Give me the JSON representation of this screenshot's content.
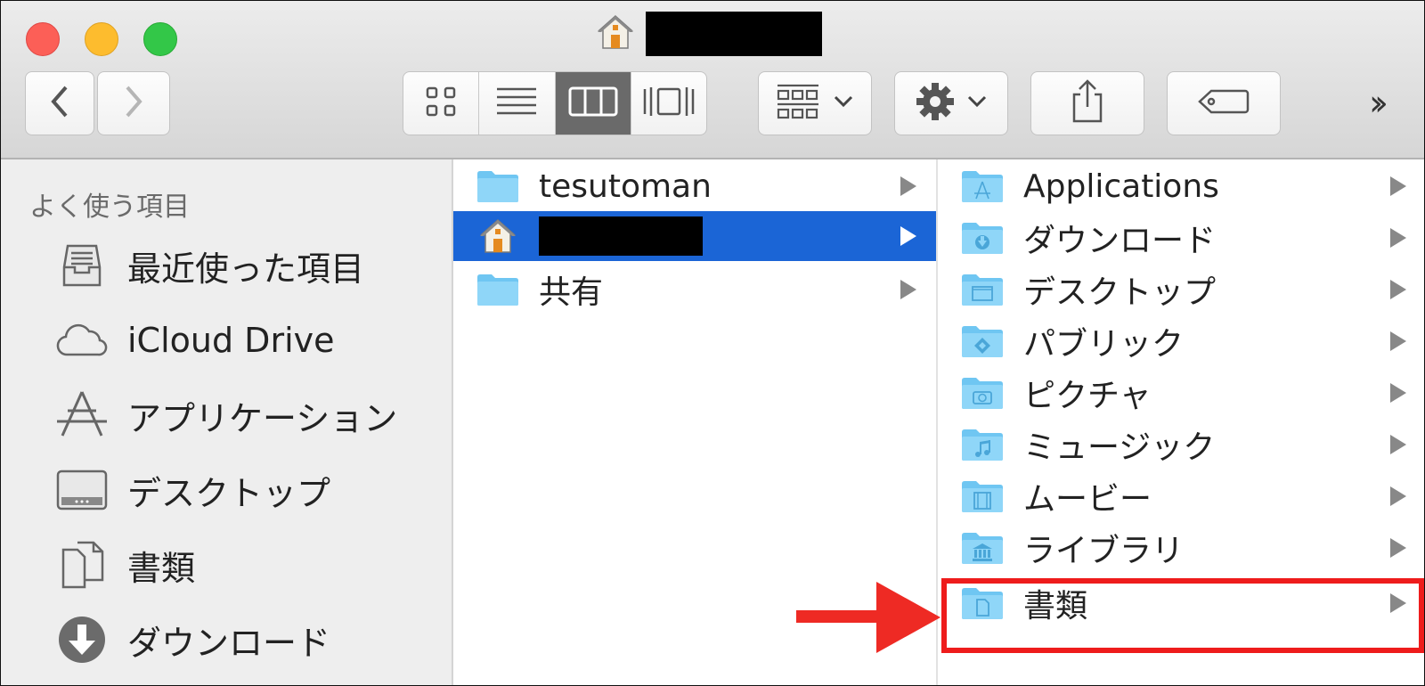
{
  "window": {
    "title_redacted": true
  },
  "toolbar": {
    "nav": {
      "back": "back-chevron-icon",
      "forward": "forward-chevron-icon"
    },
    "view_modes": [
      {
        "name": "icon-view",
        "active": false
      },
      {
        "name": "list-view",
        "active": false
      },
      {
        "name": "column-view",
        "active": true
      },
      {
        "name": "cover-flow-view",
        "active": false
      }
    ],
    "more_label": "››"
  },
  "sidebar": {
    "heading": "よく使う項目",
    "items": [
      {
        "label": "最近使った項目",
        "icon": "recents-icon"
      },
      {
        "label": "iCloud Drive",
        "icon": "icloud-icon"
      },
      {
        "label": "アプリケーション",
        "icon": "applications-icon"
      },
      {
        "label": "デスクトップ",
        "icon": "desktop-icon"
      },
      {
        "label": "書類",
        "icon": "documents-icon"
      },
      {
        "label": "ダウンロード",
        "icon": "downloads-icon"
      }
    ]
  },
  "column1": {
    "items": [
      {
        "label": "tesutoman",
        "icon": "folder-icon",
        "selected": false
      },
      {
        "label": "",
        "icon": "home-icon",
        "selected": true,
        "redacted": true
      },
      {
        "label": "共有",
        "icon": "folder-icon",
        "selected": false
      }
    ]
  },
  "column2": {
    "items": [
      {
        "label": "Applications",
        "icon": "applications-folder-icon"
      },
      {
        "label": "ダウンロード",
        "icon": "downloads-folder-icon"
      },
      {
        "label": "デスクトップ",
        "icon": "desktop-folder-icon"
      },
      {
        "label": "パブリック",
        "icon": "public-folder-icon"
      },
      {
        "label": "ピクチャ",
        "icon": "pictures-folder-icon"
      },
      {
        "label": "ミュージック",
        "icon": "music-folder-icon"
      },
      {
        "label": "ムービー",
        "icon": "movies-folder-icon"
      },
      {
        "label": "ライブラリ",
        "icon": "library-folder-icon"
      },
      {
        "label": "書類",
        "icon": "documents-folder-icon"
      }
    ]
  },
  "annotation": {
    "highlighted_item": "書類",
    "color": "#ee1c1c"
  },
  "colors": {
    "selection": "#1b65d6",
    "folder": "#6fc6f2",
    "sidebar_bg": "#eeeeee"
  }
}
